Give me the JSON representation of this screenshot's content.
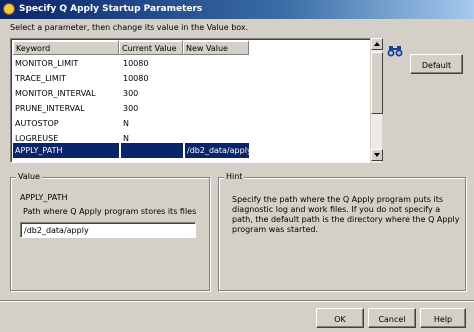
{
  "window": {
    "title": "Specify Q Apply Startup Parameters"
  },
  "instruction": "Select a parameter, then change its value in the Value box.",
  "table": {
    "columns": [
      "Keyword",
      "Current Value",
      "New Value"
    ],
    "rows": [
      {
        "keyword": "MONITOR_LIMIT",
        "current": "10080",
        "new": ""
      },
      {
        "keyword": "TRACE_LIMIT",
        "current": "10080",
        "new": ""
      },
      {
        "keyword": "MONITOR_INTERVAL",
        "current": "300",
        "new": ""
      },
      {
        "keyword": "PRUNE_INTERVAL",
        "current": "300",
        "new": ""
      },
      {
        "keyword": "AUTOSTOP",
        "current": "N",
        "new": ""
      },
      {
        "keyword": "LOGREUSE",
        "current": "N",
        "new": ""
      },
      {
        "keyword": "APPLY_PATH",
        "current": "",
        "new": "/db2_data/apply"
      }
    ],
    "selected_keyword": "APPLY_PATH"
  },
  "buttons": {
    "default": "Default",
    "ok": "OK",
    "cancel": "Cancel",
    "help": "Help"
  },
  "value_group": {
    "label": "Value",
    "name": "APPLY_PATH",
    "description": "Path where Q Apply program stores its files",
    "input_value": "/db2_data/apply"
  },
  "hint_group": {
    "label": "Hint",
    "text": "Specify the path where the Q Apply program puts its diagnostic log and work files. If you do not specify a path, the default path is the directory where the Q Apply program was started."
  },
  "colors": {
    "selection": "#0a246a",
    "dialog_bg": "#d4d0c8",
    "title_start": "#0a246a",
    "title_end": "#a6caf0"
  },
  "icons": {
    "title": "app-icon",
    "find": "binoculars-icon"
  }
}
